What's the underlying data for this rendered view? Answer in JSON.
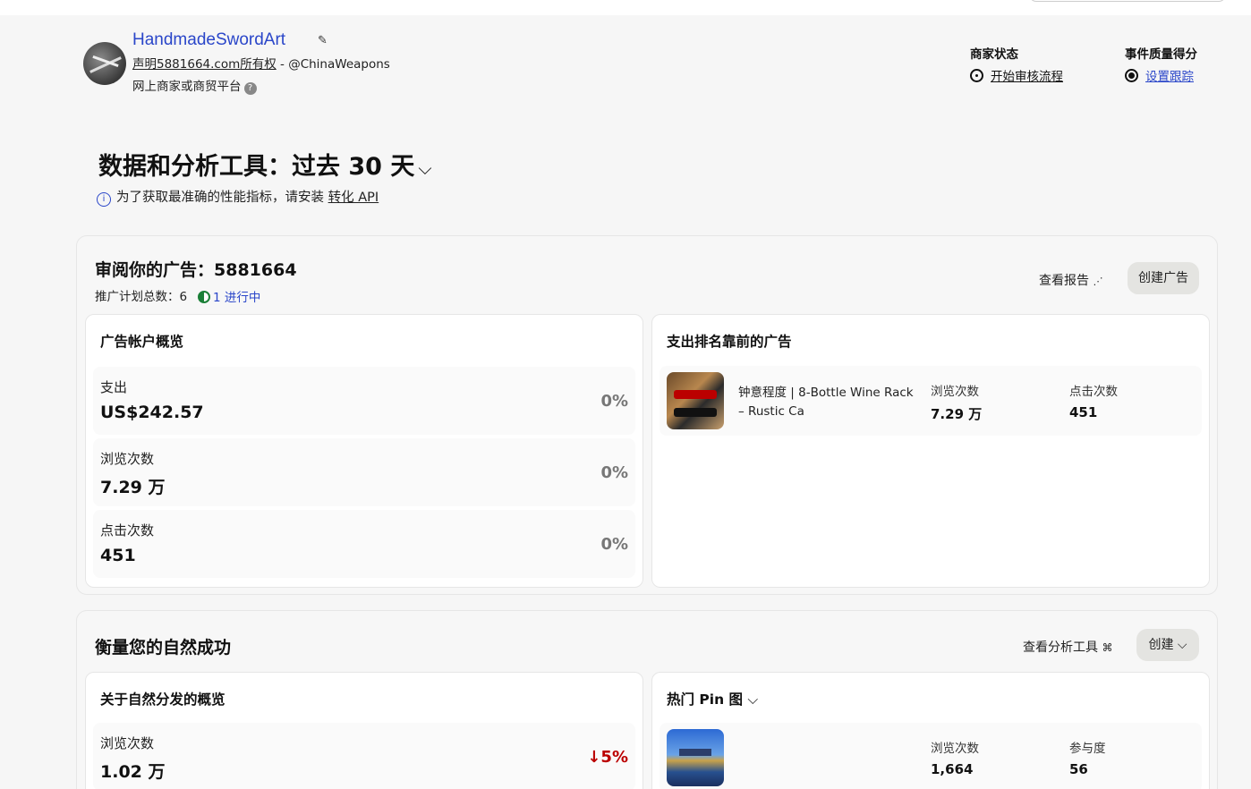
{
  "profile": {
    "name": "HandmadeSwordArt",
    "claim_text": "声明",
    "claim_domain": "5881664.com",
    "claim_suffix": "所有权",
    "claim_handle": " - @ChinaWeapons",
    "business_type": "网上商家或商贸平台"
  },
  "merchant_status": {
    "label": "商家状态",
    "value": "开始审核流程"
  },
  "event_quality": {
    "label": "事件质量得分",
    "value": "设置跟踪"
  },
  "analytics": {
    "title_prefix": "数据和分析工具：",
    "period": "过去 30 天",
    "info_text": "为了获取最准确的性能指标，请安装 ",
    "info_link": "转化 API"
  },
  "ads_review": {
    "title": "审阅你的广告：5881664",
    "campaigns": "推广计划总数：6",
    "active": "1 进行中",
    "view_report": "查看报告",
    "create_ad": "创建广告",
    "overview": {
      "title": "广告帐户概览",
      "metrics": [
        {
          "label": "支出",
          "value": "US$242.57",
          "change": "0%"
        },
        {
          "label": "浏览次数",
          "value": "7.29 万",
          "change": "0%"
        },
        {
          "label": "点击次数",
          "value": "451",
          "change": "0%"
        }
      ]
    },
    "top_ads": {
      "title": "支出排名靠前的广告",
      "items": [
        {
          "name": "钟意程度 | 8-Bottle Wine Rack – Rustic Ca",
          "views_label": "浏览次数",
          "views": "7.29 万",
          "clicks_label": "点击次数",
          "clicks": "451"
        }
      ]
    }
  },
  "organic": {
    "title": "衡量您的自然成功",
    "view_analytics": "查看分析工具",
    "create": "创建",
    "overview": {
      "title": "关于自然分发的概览",
      "metrics": [
        {
          "label": "浏览次数",
          "value": "1.02 万",
          "change": "↓5%"
        }
      ]
    },
    "top_pins": {
      "title": "热门 Pin 图",
      "items": [
        {
          "views_label": "浏览次数",
          "views": "1,664",
          "engagement_label": "参与度",
          "engagement": "56"
        }
      ]
    }
  },
  "colors": {
    "link": "#2a46c9",
    "negative": "#b00000",
    "active": "#1a7f37"
  }
}
